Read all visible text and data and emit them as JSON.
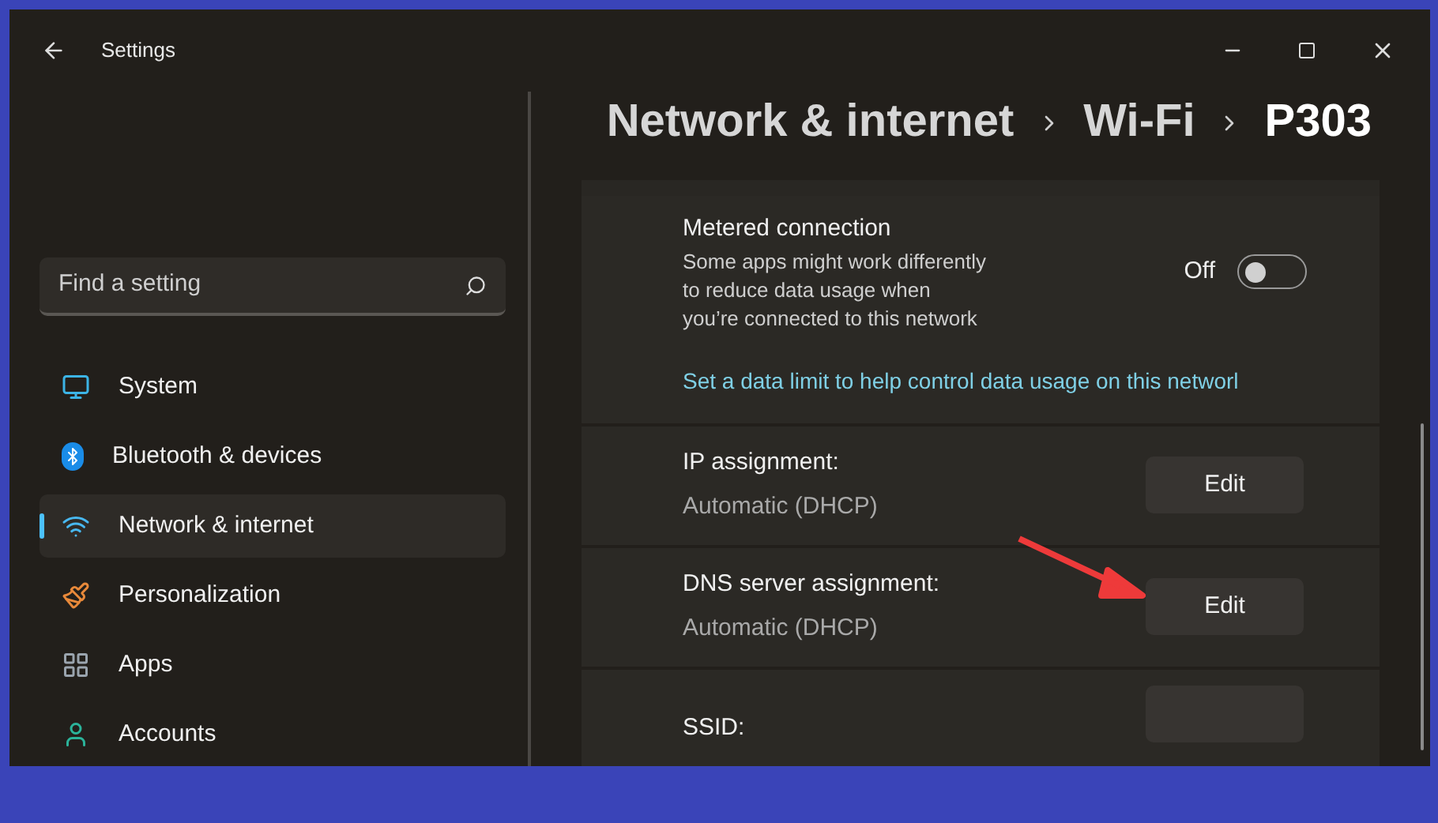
{
  "window": {
    "title": "Settings"
  },
  "search": {
    "placeholder": "Find a setting"
  },
  "sidebar": {
    "items": [
      {
        "label": "System",
        "kind": "system",
        "selected": false
      },
      {
        "label": "Bluetooth & devices",
        "kind": "bluetooth",
        "selected": false
      },
      {
        "label": "Network & internet",
        "kind": "network",
        "selected": true
      },
      {
        "label": "Personalization",
        "kind": "personalization",
        "selected": false
      },
      {
        "label": "Apps",
        "kind": "apps",
        "selected": false
      },
      {
        "label": "Accounts",
        "kind": "accounts",
        "selected": false
      }
    ]
  },
  "breadcrumb": [
    "Network & internet",
    "Wi-Fi",
    "P303"
  ],
  "metered": {
    "title": "Metered connection",
    "description": "Some apps might work differently to reduce data usage when you’re connected to this network",
    "state_label": "Off",
    "on": false,
    "link": "Set a data limit to help control data usage on this networl"
  },
  "rows": [
    {
      "label": "IP assignment:",
      "value": "Automatic (DHCP)",
      "button": "Edit",
      "annotated": false
    },
    {
      "label": "DNS server assignment:",
      "value": "Automatic (DHCP)",
      "button": "Edit",
      "annotated": true
    },
    {
      "label": "SSID:",
      "annotated": false
    }
  ]
}
